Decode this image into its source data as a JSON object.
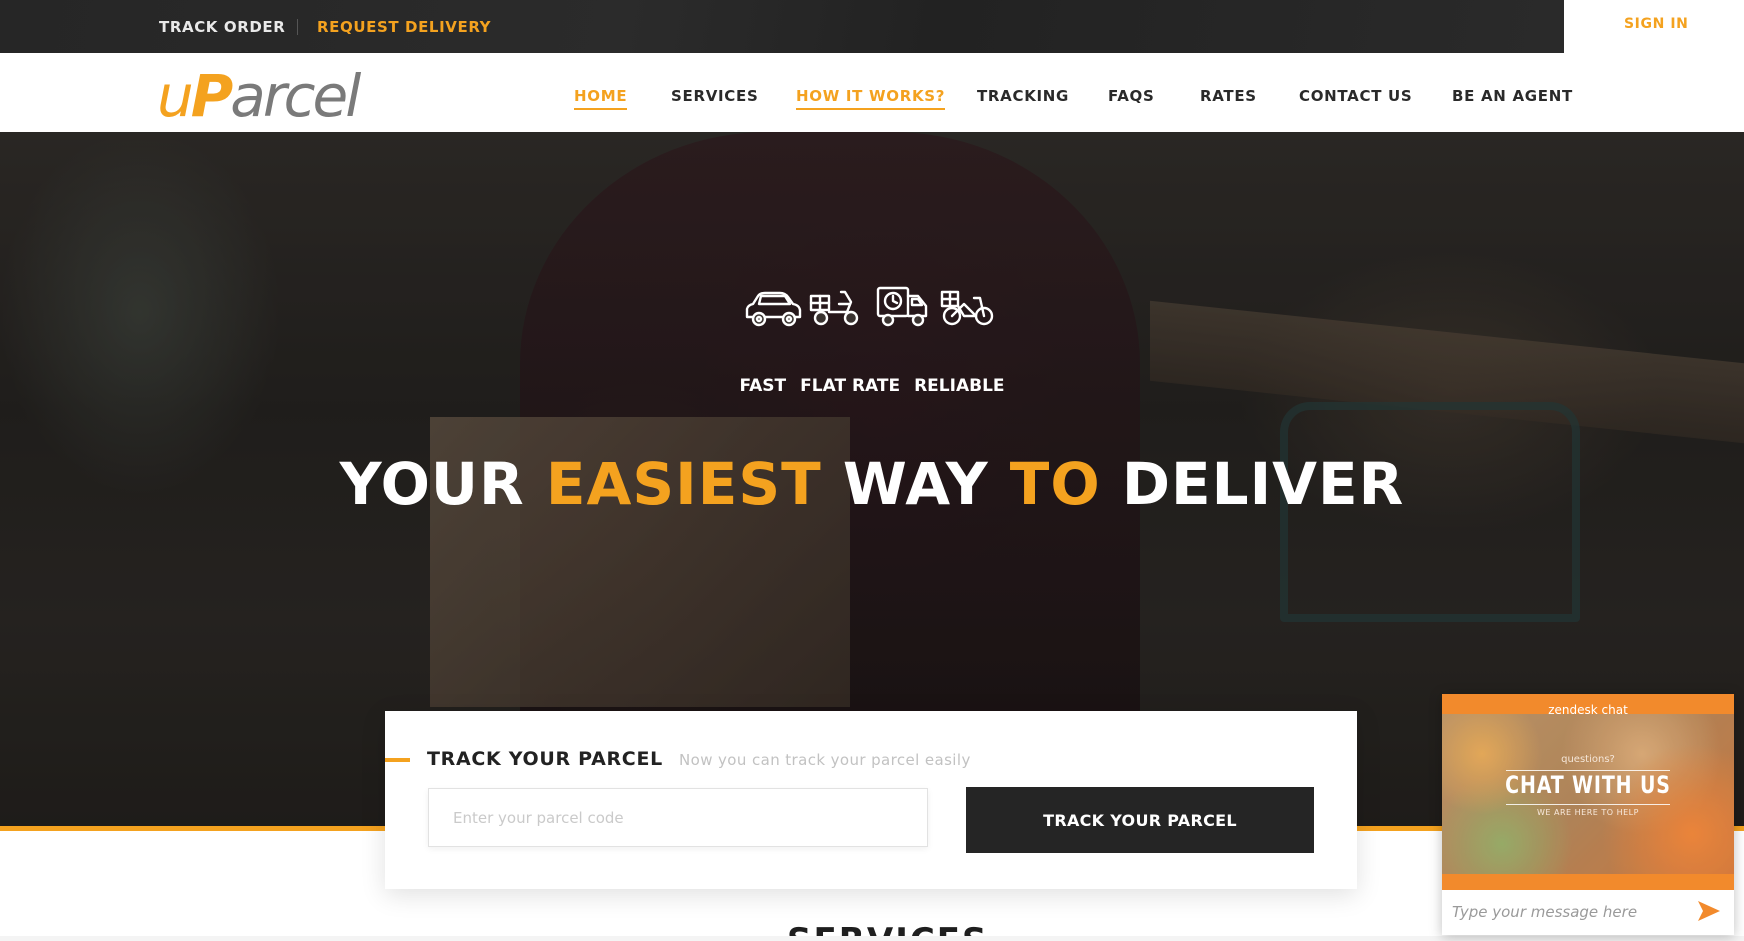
{
  "topbar": {
    "track_order": "TRACK ORDER",
    "request_delivery": "REQUEST DELIVERY",
    "sign_in": "SIGN IN"
  },
  "brand": {
    "logo_u": "u",
    "logo_p": "P",
    "logo_rest": "arcel",
    "accent_color": "#f4a21f"
  },
  "nav": {
    "items": [
      {
        "label": "HOME",
        "active": true
      },
      {
        "label": "SERVICES",
        "active": false
      },
      {
        "label": "HOW IT WORKS?",
        "active": true
      },
      {
        "label": "TRACKING",
        "active": false
      },
      {
        "label": "FAQS",
        "active": false
      },
      {
        "label": "RATES",
        "active": false
      },
      {
        "label": "CONTACT US",
        "active": false
      },
      {
        "label": "BE AN AGENT",
        "active": false
      }
    ]
  },
  "hero": {
    "vehicle_icons": [
      "car-icon",
      "motorcycle-icon",
      "delivery-truck-icon",
      "bicycle-icon"
    ],
    "taglines": [
      "FAST",
      "FLAT RATE",
      "RELIABLE"
    ],
    "headline_parts": [
      {
        "text": "YOUR ",
        "accent": false
      },
      {
        "text": "EASIEST ",
        "accent": true
      },
      {
        "text": "WAY ",
        "accent": false
      },
      {
        "text": "TO ",
        "accent": true
      },
      {
        "text": "DELIVER",
        "accent": false
      }
    ]
  },
  "track": {
    "title": "TRACK YOUR PARCEL",
    "subtitle": "Now you can track your parcel easily",
    "placeholder": "Enter your parcel code",
    "value": "",
    "button_label": "TRACK YOUR PARCEL"
  },
  "services": {
    "heading": "SERVICES"
  },
  "chat": {
    "brand": "zendesk chat",
    "question": "questions?",
    "cta": "CHAT WITH US",
    "small": "WE ARE HERE TO HELP",
    "placeholder": "Type your message here",
    "header_color": "#f28a2c",
    "send_icon": "send-arrow-icon"
  }
}
